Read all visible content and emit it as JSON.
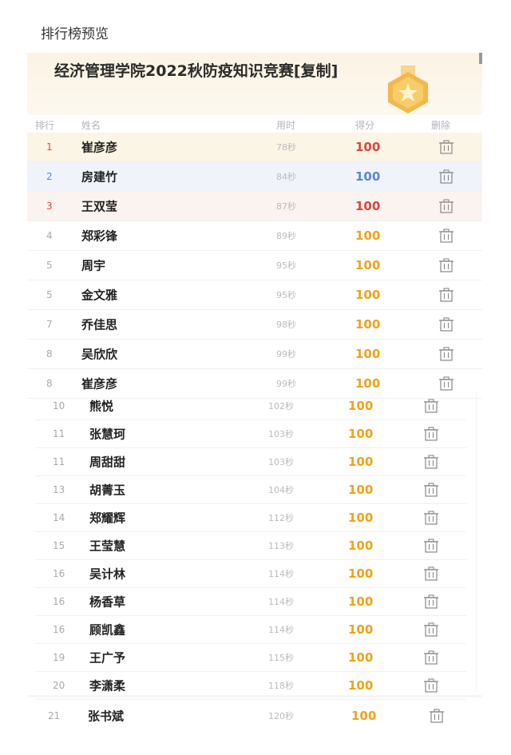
{
  "page": {
    "title": "排行榜预览"
  },
  "banner": {
    "title": "经济管理学院2022秋防疫知识竞赛[复制]"
  },
  "columns": {
    "rank": "排行",
    "name": "姓名",
    "time": "用时",
    "score": "得分",
    "delete": "删除"
  },
  "colors": {
    "gold": "#f0a21a",
    "blue": "#5b86d6",
    "red": "#d9463a",
    "rank1": "#e2473b",
    "rank2": "#5b86d6",
    "rank3": "#e2473b"
  },
  "rows": [
    {
      "rank": "1",
      "name": "崔彦彦",
      "time": "78秒",
      "score": "100"
    },
    {
      "rank": "2",
      "name": "房建竹",
      "time": "84秒",
      "score": "100"
    },
    {
      "rank": "3",
      "name": "王双莹",
      "time": "87秒",
      "score": "100"
    },
    {
      "rank": "4",
      "name": "郑彩锋",
      "time": "89秒",
      "score": "100"
    },
    {
      "rank": "5",
      "name": "周宇",
      "time": "95秒",
      "score": "100"
    },
    {
      "rank": "5",
      "name": "金文雅",
      "time": "95秒",
      "score": "100"
    },
    {
      "rank": "7",
      "name": "乔佳思",
      "time": "98秒",
      "score": "100"
    },
    {
      "rank": "8",
      "name": "吴欣欣",
      "time": "99秒",
      "score": "100"
    },
    {
      "rank": "8",
      "name": "崔彦彦",
      "time": "99秒",
      "score": "100"
    }
  ],
  "rows2": [
    {
      "rank": "10",
      "name": "熊悦",
      "time": "102秒",
      "score": "100"
    },
    {
      "rank": "11",
      "name": "张慧珂",
      "time": "103秒",
      "score": "100"
    },
    {
      "rank": "11",
      "name": "周甜甜",
      "time": "103秒",
      "score": "100"
    },
    {
      "rank": "13",
      "name": "胡菁玉",
      "time": "104秒",
      "score": "100"
    },
    {
      "rank": "14",
      "name": "郑耀辉",
      "time": "112秒",
      "score": "100"
    },
    {
      "rank": "15",
      "name": "王莹慧",
      "time": "113秒",
      "score": "100"
    },
    {
      "rank": "16",
      "name": "吴计林",
      "time": "114秒",
      "score": "100"
    },
    {
      "rank": "16",
      "name": "杨香草",
      "time": "114秒",
      "score": "100"
    },
    {
      "rank": "16",
      "name": "顾凯鑫",
      "time": "114秒",
      "score": "100"
    },
    {
      "rank": "19",
      "name": "王广予",
      "time": "115秒",
      "score": "100"
    },
    {
      "rank": "20",
      "name": "李潇柔",
      "time": "118秒",
      "score": "100"
    }
  ],
  "last": {
    "rank": "21",
    "name": "张书斌",
    "time": "120秒",
    "score": "100"
  }
}
